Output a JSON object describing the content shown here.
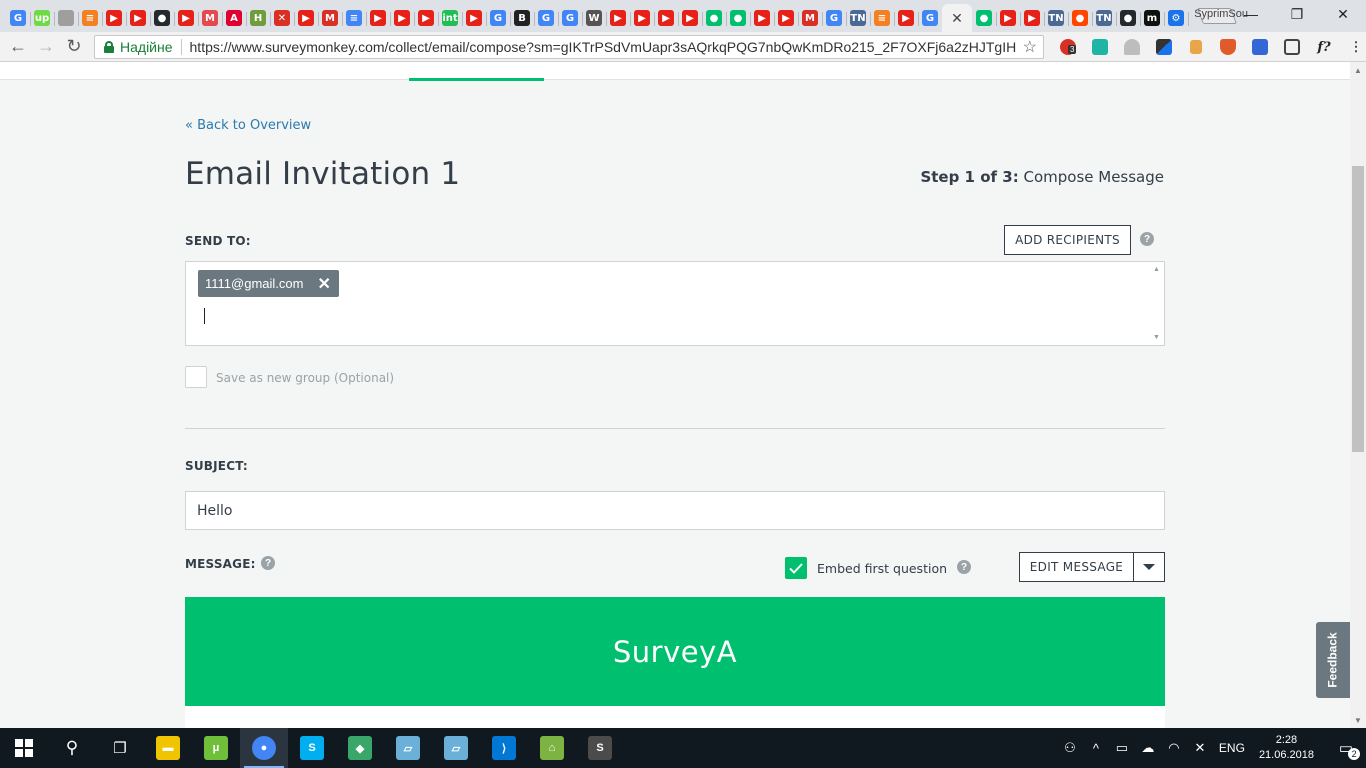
{
  "browser": {
    "profile_name": "SyprimSou",
    "tab_favicons": [
      {
        "name": "google-translate",
        "color": "#4285f4",
        "glyph": "G"
      },
      {
        "name": "upwork",
        "color": "#6fda44",
        "glyph": "up"
      },
      {
        "name": "doc",
        "color": "#9e9e9e",
        "glyph": ""
      },
      {
        "name": "stackoverflow",
        "color": "#f48024",
        "glyph": "≡"
      },
      {
        "name": "youtube",
        "color": "#e62117",
        "glyph": "▶"
      },
      {
        "name": "youtube",
        "color": "#e62117",
        "glyph": "▶"
      },
      {
        "name": "github",
        "color": "#24292e",
        "glyph": "●"
      },
      {
        "name": "youtube",
        "color": "#e62117",
        "glyph": "▶"
      },
      {
        "name": "mashable",
        "color": "#e5484d",
        "glyph": "M"
      },
      {
        "name": "angular",
        "color": "#dd0031",
        "glyph": "A"
      },
      {
        "name": "habr",
        "color": "#6f9c3d",
        "glyph": "H"
      },
      {
        "name": "tool",
        "color": "#d93025",
        "glyph": "✕"
      },
      {
        "name": "youtube",
        "color": "#e62117",
        "glyph": "▶"
      },
      {
        "name": "gmail",
        "color": "#d93025",
        "glyph": "M"
      },
      {
        "name": "google-docs",
        "color": "#4285f4",
        "glyph": "≡"
      },
      {
        "name": "youtube",
        "color": "#e62117",
        "glyph": "▶"
      },
      {
        "name": "youtube",
        "color": "#e62117",
        "glyph": "▶"
      },
      {
        "name": "youtube",
        "color": "#e62117",
        "glyph": "▶"
      },
      {
        "name": "intellij",
        "color": "#20bf55",
        "glyph": "int"
      },
      {
        "name": "youtube",
        "color": "#e62117",
        "glyph": "▶"
      },
      {
        "name": "google-translate",
        "color": "#4285f4",
        "glyph": "G"
      },
      {
        "name": "odnoklassniki",
        "color": "#222",
        "glyph": "B"
      },
      {
        "name": "google",
        "color": "#4285f4",
        "glyph": "G"
      },
      {
        "name": "google",
        "color": "#4285f4",
        "glyph": "G"
      },
      {
        "name": "wikipedia",
        "color": "#555",
        "glyph": "W"
      },
      {
        "name": "youtube",
        "color": "#e62117",
        "glyph": "▶"
      },
      {
        "name": "youtube",
        "color": "#e62117",
        "glyph": "▶"
      },
      {
        "name": "youtube",
        "color": "#e62117",
        "glyph": "▶"
      },
      {
        "name": "youtube",
        "color": "#e62117",
        "glyph": "▶"
      },
      {
        "name": "surveymonkey",
        "color": "#00bf6f",
        "glyph": "●"
      },
      {
        "name": "surveymonkey",
        "color": "#00bf6f",
        "glyph": "●"
      },
      {
        "name": "youtube",
        "color": "#e62117",
        "glyph": "▶"
      },
      {
        "name": "youtube",
        "color": "#e62117",
        "glyph": "▶"
      },
      {
        "name": "gmail",
        "color": "#d93025",
        "glyph": "M"
      },
      {
        "name": "google",
        "color": "#4285f4",
        "glyph": "G"
      },
      {
        "name": "tn",
        "color": "#4a6a94",
        "glyph": "TN"
      },
      {
        "name": "stackoverflow",
        "color": "#f48024",
        "glyph": "≡"
      },
      {
        "name": "youtube",
        "color": "#e62117",
        "glyph": "▶"
      },
      {
        "name": "google",
        "color": "#4285f4",
        "glyph": "G"
      }
    ],
    "tab_favicons_after": [
      {
        "name": "surveymonkey",
        "color": "#00bf6f",
        "glyph": "●"
      },
      {
        "name": "youtube",
        "color": "#e62117",
        "glyph": "▶"
      },
      {
        "name": "youtube",
        "color": "#e62117",
        "glyph": "▶"
      },
      {
        "name": "tn",
        "color": "#4a6a94",
        "glyph": "TN"
      },
      {
        "name": "reddit",
        "color": "#ff4500",
        "glyph": "●"
      },
      {
        "name": "tn",
        "color": "#4a6a94",
        "glyph": "TN"
      },
      {
        "name": "github",
        "color": "#24292e",
        "glyph": "●"
      },
      {
        "name": "medium",
        "color": "#111",
        "glyph": "m"
      },
      {
        "name": "settings",
        "color": "#1a73e8",
        "glyph": "⚙"
      }
    ],
    "active_tab_close": "✕",
    "window_controls": {
      "minimize": "—",
      "restore": "❐",
      "close": "✕"
    },
    "secure_label": "Надійне",
    "url": "https://www.surveymonkey.com/collect/email/compose?sm=gIKTrPSdVmUapr3sAQrkqPQG7nbQwKmDRo215_2F7OXFj6a2zHJTgIHQ...",
    "ext_badge": "3",
    "ext_formula": "f?"
  },
  "page": {
    "back_link": "« Back to Overview",
    "title": "Email Invitation 1",
    "step_prefix": "Step 1 of 3:",
    "step_name": "Compose Message",
    "send_to_label": "SEND TO:",
    "add_recipients_label": "ADD RECIPIENTS",
    "help_glyph": "?",
    "recipients": [
      "1111@gmail.com"
    ],
    "chip_remove": "✕",
    "save_group_label": "Save as new group (Optional)",
    "subject_label": "SUBJECT:",
    "subject_value": "Hello",
    "message_label": "MESSAGE:",
    "embed_label": "Embed first question",
    "embed_checked": true,
    "edit_message_label": "EDIT MESSAGE",
    "survey_name": "SurveyA",
    "accent_color": "#00bf6f",
    "feedback_label": "Feedback"
  },
  "taskbar": {
    "apps": [
      {
        "name": "file-explorer",
        "color": "#f0c400",
        "glyph": "▬"
      },
      {
        "name": "utorrent",
        "color": "#6fbf3a",
        "glyph": "μ"
      },
      {
        "name": "chrome",
        "color": "#4285f4",
        "glyph": "●"
      },
      {
        "name": "skype",
        "color": "#00aff0",
        "glyph": "S"
      },
      {
        "name": "git-kraken",
        "color": "#3aa66a",
        "glyph": "◆"
      },
      {
        "name": "app-blue-1",
        "color": "#6ab0d8",
        "glyph": "▱"
      },
      {
        "name": "app-blue-2",
        "color": "#6ab0d8",
        "glyph": "▱"
      },
      {
        "name": "vscode",
        "color": "#0078d4",
        "glyph": "⟩"
      },
      {
        "name": "android-studio",
        "color": "#7cb342",
        "glyph": "⌂"
      },
      {
        "name": "sublime",
        "color": "#4b4b4b",
        "glyph": "S"
      }
    ],
    "language": "ENG",
    "time": "2:28",
    "date": "21.06.2018",
    "notification_count": "2"
  }
}
